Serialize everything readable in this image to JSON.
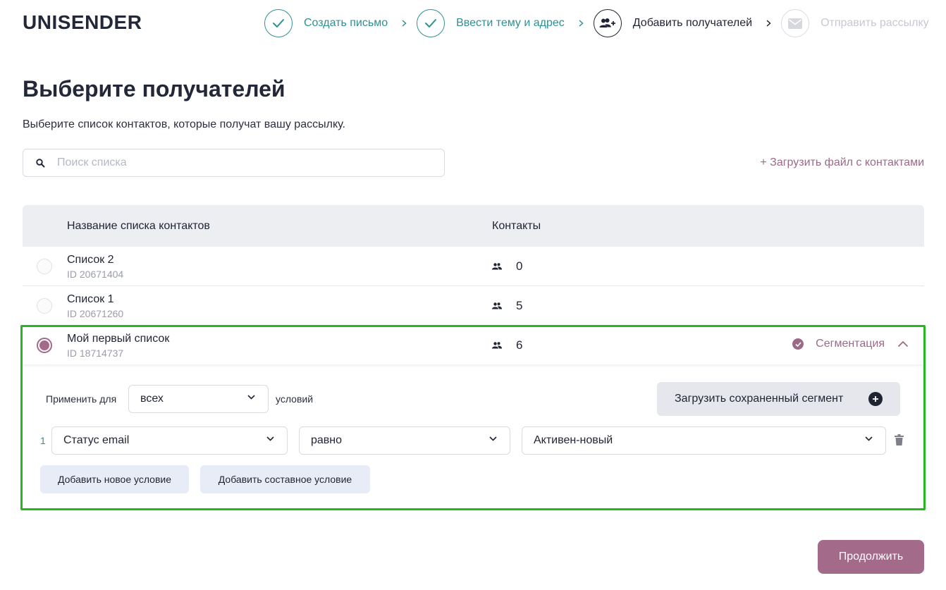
{
  "app": {
    "logo": "UNISENDER"
  },
  "steps": [
    {
      "label": "Создать письмо",
      "state": "done",
      "icon": "check-icon"
    },
    {
      "label": "Ввести тему и адрес",
      "state": "done",
      "icon": "check-icon"
    },
    {
      "label": "Добавить получателей",
      "state": "current",
      "icon": "add-user-icon"
    },
    {
      "label": "Отправить рассылку",
      "state": "pending",
      "icon": "envelope-icon"
    }
  ],
  "page": {
    "title": "Выберите получателей",
    "subtitle": "Выберите список контактов, которые получат вашу рассылку."
  },
  "search": {
    "placeholder": "Поиск списка",
    "value": ""
  },
  "upload_link": "+ Загрузить файл с контактами",
  "table": {
    "headers": {
      "name": "Название списка контактов",
      "contacts": "Контакты"
    },
    "rows": [
      {
        "name": "Список 2",
        "id": "ID 20671404",
        "contacts": "0",
        "selected": false
      },
      {
        "name": "Список 1",
        "id": "ID 20671260",
        "contacts": "5",
        "selected": false
      },
      {
        "name": "Мой первый список",
        "id": "ID 18714737",
        "contacts": "6",
        "selected": true,
        "segmentation": "Сегментация"
      }
    ]
  },
  "segmentation": {
    "apply_label": "Применить для",
    "apply_value": "всех",
    "conditions_label": "условий",
    "load_saved_button": "Загрузить сохраненный сегмент",
    "conditions": [
      {
        "num": "1",
        "field": "Статус email",
        "operator": "равно",
        "value": "Активен-новый"
      }
    ],
    "add_condition_button": "Добавить новое условие",
    "add_compound_button": "Добавить составное условие"
  },
  "continue_button": "Продолжить",
  "colors": {
    "accent": "#a36a8a",
    "teal": "#2f8f93",
    "highlight_frame": "#22b81e",
    "header_bg": "#eceef1"
  }
}
